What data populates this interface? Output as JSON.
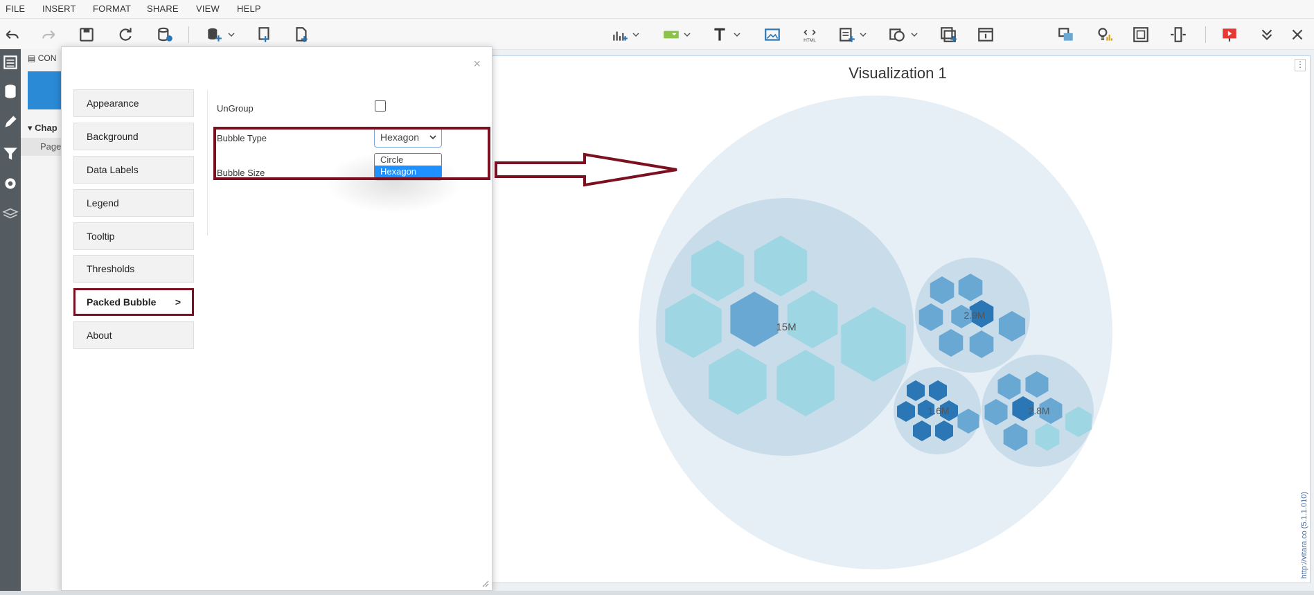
{
  "menubar": {
    "items": [
      "FILE",
      "INSERT",
      "FORMAT",
      "SHARE",
      "VIEW",
      "HELP"
    ]
  },
  "left_panel": {
    "header": "CON",
    "section": "Chap",
    "page": "Page"
  },
  "viz": {
    "title": "Visualization 1",
    "credit": "http://vitara.co (5.1.1.010)",
    "menu_glyph": "⋮",
    "bubble_labels": [
      "15M",
      "2.9M",
      "1.6M",
      "2.8M"
    ],
    "colors": {
      "outer": "#e6eef6",
      "group": "#c9dcea",
      "hex_light": "#9ed6e3",
      "hex_mid": "#6aa8d4",
      "hex_dark": "#2b77b5"
    }
  },
  "dialog": {
    "close_glyph": "×",
    "nav": [
      "Appearance",
      "Background",
      "Data Labels",
      "Legend",
      "Tooltip",
      "Thresholds",
      "Packed Bubble",
      "About"
    ],
    "nav_active_arrow": ">",
    "props": {
      "ungroup_label": "UnGroup",
      "bubble_type_label": "Bubble Type",
      "bubble_type_value": "Hexagon",
      "bubble_size_label": "Bubble Size",
      "options": [
        "Circle",
        "Hexagon"
      ]
    }
  },
  "annotation_color": "#7b1020"
}
